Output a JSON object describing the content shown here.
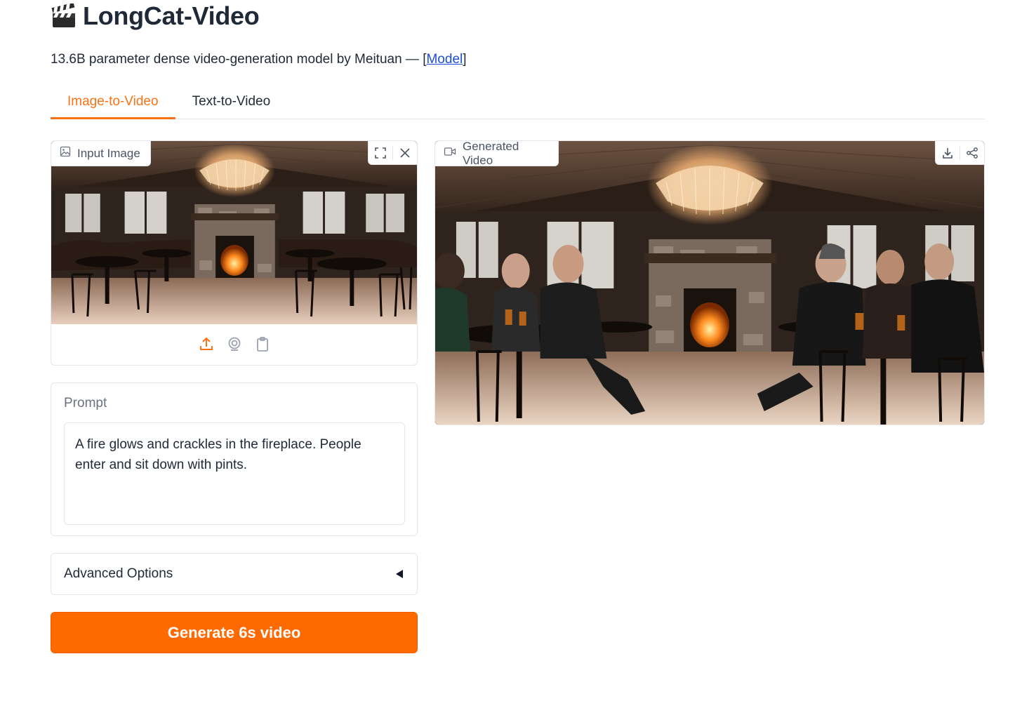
{
  "header": {
    "title": "LongCat-Video",
    "subtitle_text": "13.6B parameter dense video-generation model by Meituan — [",
    "subtitle_link": "Model",
    "subtitle_end": "]"
  },
  "tabs": [
    {
      "label": "Image-to-Video",
      "active": true
    },
    {
      "label": "Text-to-Video",
      "active": false
    }
  ],
  "input_image": {
    "label": "Input Image",
    "tools": [
      "fullscreen-icon",
      "close-icon"
    ],
    "sources": [
      "upload-icon",
      "webcam-icon",
      "clipboard-icon"
    ]
  },
  "generated_video": {
    "label": "Generated Video",
    "tools": [
      "download-icon",
      "share-icon"
    ]
  },
  "prompt": {
    "label": "Prompt",
    "value": "A fire glows and crackles in the fireplace. People enter and sit down with pints."
  },
  "advanced": {
    "label": "Advanced Options",
    "collapsed": true
  },
  "generate_button": {
    "label": "Generate 6s video"
  },
  "colors": {
    "accent": "#ff6a00",
    "tab_active": "#f97316",
    "link": "#1d4ed8",
    "border": "#e5e7eb"
  }
}
